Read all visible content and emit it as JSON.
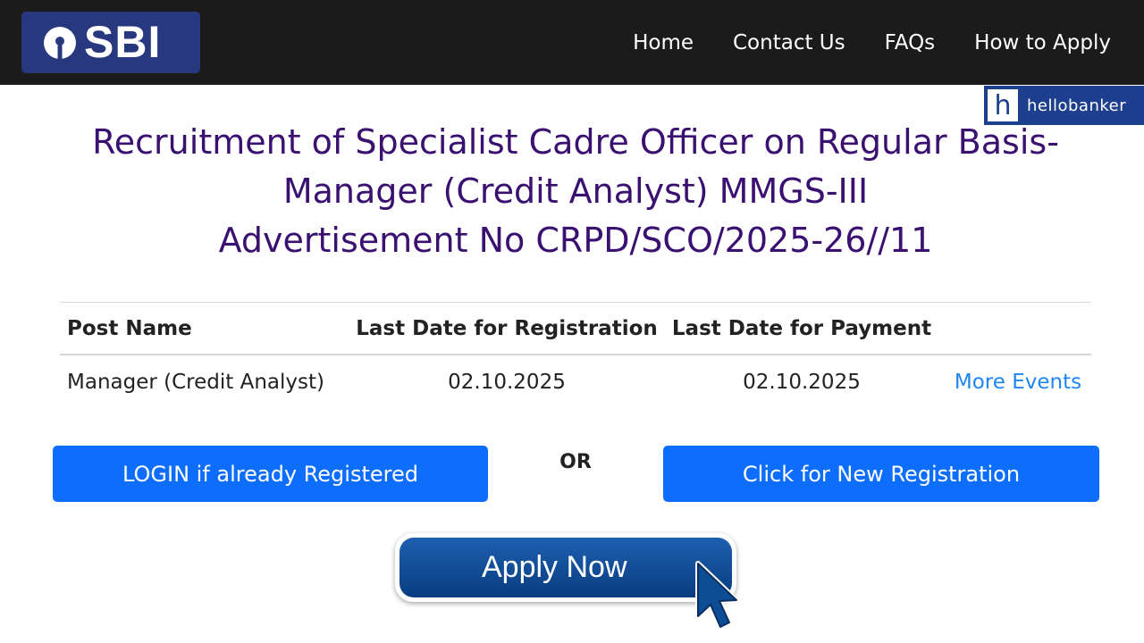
{
  "header": {
    "logo_text": "SBI",
    "nav": [
      "Home",
      "Contact Us",
      "FAQs",
      "How to Apply"
    ]
  },
  "watermark": {
    "mark": "h",
    "text": "hellobanker"
  },
  "title": {
    "line1": "Recruitment of Specialist Cadre Officer on Regular Basis-",
    "line2": "Manager (Credit Analyst) MMGS-III",
    "line3": "Advertisement No CRPD/SCO/2025-26//11"
  },
  "table": {
    "headers": [
      "Post Name",
      "Last Date for Registration",
      "Last Date for Payment"
    ],
    "row": {
      "post_name": "Manager (Credit Analyst)",
      "last_date_registration": "02.10.2025",
      "last_date_payment": "02.10.2025",
      "link": "More Events"
    }
  },
  "actions": {
    "login_label": "LOGIN if already Registered",
    "or_label": "OR",
    "register_label": "Click for New Registration",
    "apply_label": "Apply Now"
  },
  "colors": {
    "header_bg": "#1b1b1b",
    "logo_bg": "#28387e",
    "title": "#3a1070",
    "primary_button": "#0d6efd",
    "link": "#1f86f0",
    "apply_button": "#0a4b95"
  },
  "icons": [
    "sbi-logo-icon",
    "cursor-arrow-icon"
  ]
}
